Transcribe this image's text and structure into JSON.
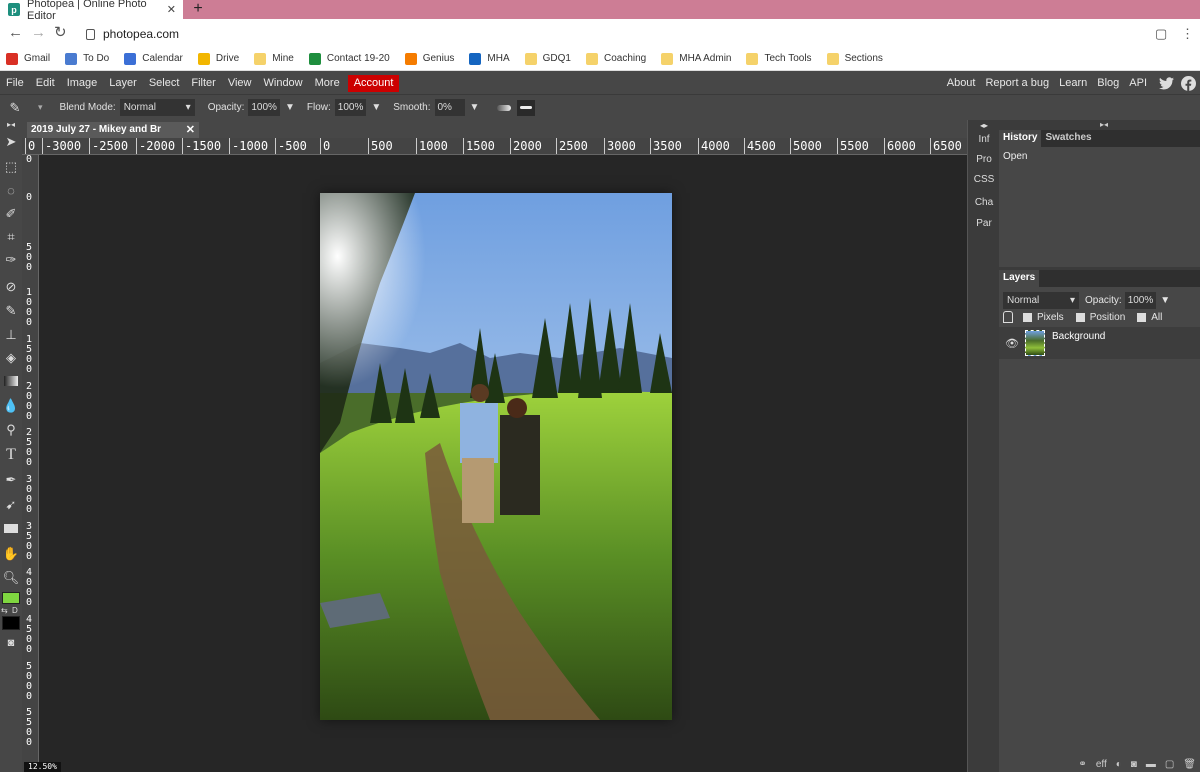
{
  "browser": {
    "tab_title": "Photopea | Online Photo Editor",
    "tab_close": "✕",
    "new_tab": "+",
    "url": "photopea.com"
  },
  "bookmarks": [
    {
      "label": "Gmail",
      "icon": "gmail-icon",
      "color": "#d93025"
    },
    {
      "label": "To Do",
      "icon": "todo-icon",
      "color": "#4a7bd0"
    },
    {
      "label": "Calendar",
      "icon": "calendar-icon",
      "color": "#3b6fd6"
    },
    {
      "label": "Drive",
      "icon": "drive-icon",
      "color": "#f2b600"
    },
    {
      "label": "Mine",
      "icon": "folder-icon",
      "color": "#f5d26a"
    },
    {
      "label": "Contact 19-20",
      "icon": "sheets-icon",
      "color": "#1e8e3e"
    },
    {
      "label": "Genius",
      "icon": "genius-icon",
      "color": "#f57c00"
    },
    {
      "label": "MHA",
      "icon": "mha-icon",
      "color": "#1565c0"
    },
    {
      "label": "GDQ1",
      "icon": "folder-icon",
      "color": "#f5d26a"
    },
    {
      "label": "Coaching",
      "icon": "folder-icon",
      "color": "#f5d26a"
    },
    {
      "label": "MHA Admin",
      "icon": "folder-icon",
      "color": "#f5d26a"
    },
    {
      "label": "Tech Tools",
      "icon": "folder-icon",
      "color": "#f5d26a"
    },
    {
      "label": "Sections",
      "icon": "folder-icon",
      "color": "#f5d26a"
    }
  ],
  "menubar": {
    "items": [
      "File",
      "Edit",
      "Image",
      "Layer",
      "Select",
      "Filter",
      "View",
      "Window",
      "More"
    ],
    "account": "Account",
    "right_items": [
      "About",
      "Report a bug",
      "Learn",
      "Blog",
      "API"
    ]
  },
  "options": {
    "blend_label": "Blend Mode:",
    "blend_value": "Normal",
    "opacity_label": "Opacity:",
    "opacity_value": "100%",
    "flow_label": "Flow:",
    "flow_value": "100%",
    "smooth_label": "Smooth:",
    "smooth_value": "0%"
  },
  "document": {
    "tab_title": "2019 July 27 - Mikey and Br",
    "tab_close": "✕",
    "zoom": "12.50%"
  },
  "ruler": {
    "top": [
      "0",
      "-3000",
      "-2500",
      "-2000",
      "-1500",
      "-1000",
      "-500",
      "0",
      "500",
      "1000",
      "1500",
      "2000",
      "2500",
      "3000",
      "3500",
      "4000",
      "4500",
      "5000",
      "5500",
      "6000",
      "6500"
    ],
    "left": [
      "0",
      "0",
      "5\n0\n0",
      "1\n0\n0\n0",
      "1\n5\n0\n0",
      "2\n0\n0\n0",
      "2\n5\n0\n0",
      "3\n0\n0\n0",
      "3\n5\n0\n0",
      "4\n0\n0\n0",
      "4\n5\n0\n0",
      "5\n0\n0\n0",
      "5\n5\n0\n0"
    ]
  },
  "minipanel": [
    "Inf",
    "Pro",
    "CSS",
    "Cha",
    "Par"
  ],
  "history": {
    "tabs": [
      "History",
      "Swatches"
    ],
    "items": [
      "Open"
    ]
  },
  "layers": {
    "title": "Layers",
    "blend": "Normal",
    "opacity_label": "Opacity:",
    "opacity_value": "100%",
    "lock_pixels": "Pixels",
    "lock_position": "Position",
    "lock_all": "All",
    "layer_name": "Background",
    "footer_eff": "eff"
  },
  "colors": {
    "foreground": "#7fd640",
    "background": "#000000",
    "account_red": "#cc0000",
    "tabbar_pink": "#cd7d95"
  }
}
